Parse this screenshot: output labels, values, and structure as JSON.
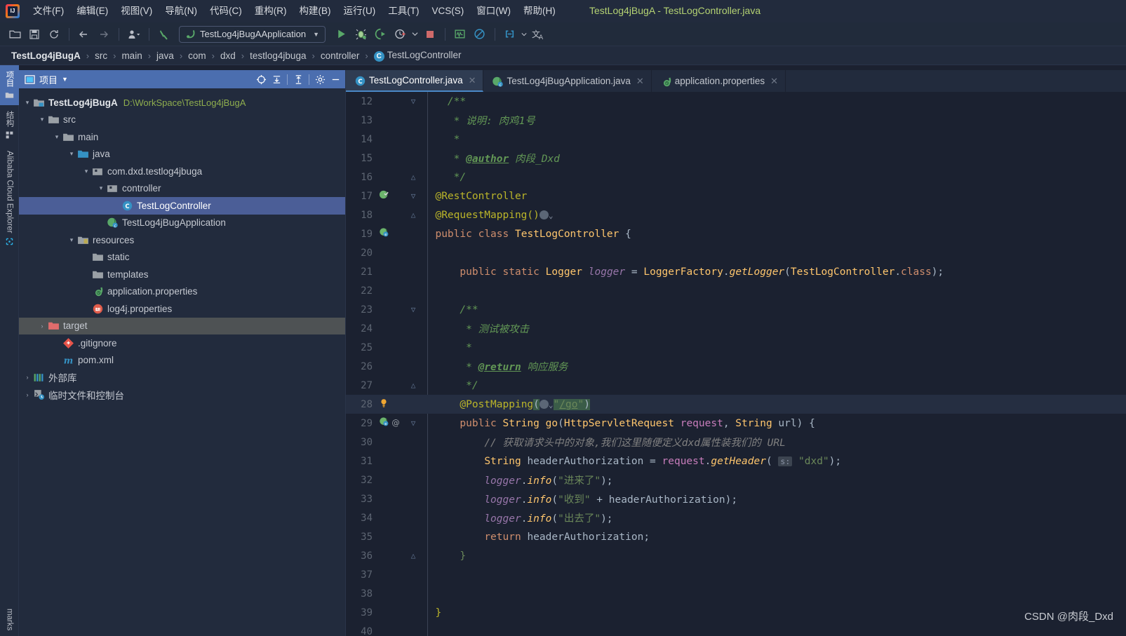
{
  "window": {
    "title": "TestLog4jBugA - TestLogController.java",
    "logo_icon": "intellij-idea-logo"
  },
  "menubar": {
    "items": [
      {
        "label": "文件(F)",
        "name": "menu-file"
      },
      {
        "label": "编辑(E)",
        "name": "menu-edit"
      },
      {
        "label": "视图(V)",
        "name": "menu-view"
      },
      {
        "label": "导航(N)",
        "name": "menu-navigate"
      },
      {
        "label": "代码(C)",
        "name": "menu-code"
      },
      {
        "label": "重构(R)",
        "name": "menu-refactor"
      },
      {
        "label": "构建(B)",
        "name": "menu-build"
      },
      {
        "label": "运行(U)",
        "name": "menu-run"
      },
      {
        "label": "工具(T)",
        "name": "menu-tools"
      },
      {
        "label": "VCS(S)",
        "name": "menu-vcs"
      },
      {
        "label": "窗口(W)",
        "name": "menu-window"
      },
      {
        "label": "帮助(H)",
        "name": "menu-help"
      }
    ]
  },
  "toolbar": {
    "run_configuration": "TestLog4jBugAApplication",
    "run_config_caret": "▼",
    "icons": [
      "open-folder-icon",
      "save-icon",
      "sync-refresh-icon",
      "back-arrow-icon",
      "forward-arrow-icon",
      "profile-user-icon",
      "build-hammer-icon",
      "run-icon",
      "debug-icon",
      "run-with-coverage-icon",
      "profiler-icon",
      "stop-icon",
      "monitor-icon",
      "no-entry-icon",
      "link-icon",
      "translate-icon"
    ]
  },
  "breadcrumb": {
    "items": [
      "TestLog4jBugA",
      "src",
      "main",
      "java",
      "com",
      "dxd",
      "testlog4jbuga",
      "controller",
      "TestLogController"
    ],
    "separator": "›",
    "class_icon_letter": "C"
  },
  "left_rail": {
    "top_items": [
      {
        "label": "项目",
        "icon": "project-folder-icon",
        "active": true,
        "name": "rail-project"
      },
      {
        "label": "结构",
        "icon": "structure-icon",
        "active": false,
        "name": "rail-structure"
      },
      {
        "label": "Alibaba Cloud Explorer",
        "icon": "cloud-explorer-icon",
        "active": false,
        "name": "rail-alibaba-cloud-explorer"
      }
    ],
    "bottom_items": [
      {
        "label": "marks",
        "icon": "bookmarks-icon",
        "active": false,
        "name": "rail-bookmarks"
      }
    ]
  },
  "project_panel": {
    "header_title": "项目",
    "header_caret": "▼",
    "header_icons": [
      "select-opened-file-icon",
      "expand-all-icon",
      "collapse-all-icon",
      "gear-icon",
      "hide-icon"
    ],
    "tree": [
      {
        "depth": 0,
        "arrow": "▾",
        "icon": "module-folder-icon",
        "label": "TestLog4jBugA",
        "bold": true,
        "path": "D:\\WorkSpace\\TestLog4jBugA",
        "state": "normal",
        "name": "tree-node-project-root"
      },
      {
        "depth": 1,
        "arrow": "▾",
        "icon": "folder-icon",
        "label": "src",
        "bold": false,
        "path": "",
        "state": "normal",
        "name": "tree-node-src"
      },
      {
        "depth": 2,
        "arrow": "▾",
        "icon": "folder-icon",
        "label": "main",
        "bold": false,
        "path": "",
        "state": "normal",
        "name": "tree-node-main"
      },
      {
        "depth": 3,
        "arrow": "▾",
        "icon": "source-folder-icon",
        "label": "java",
        "bold": false,
        "path": "",
        "state": "normal",
        "name": "tree-node-java"
      },
      {
        "depth": 4,
        "arrow": "▾",
        "icon": "package-icon",
        "label": "com.dxd.testlog4jbuga",
        "bold": false,
        "path": "",
        "state": "normal",
        "name": "tree-node-package-com-dxd-testlog4jbuga"
      },
      {
        "depth": 5,
        "arrow": "▾",
        "icon": "package-icon",
        "label": "controller",
        "bold": false,
        "path": "",
        "state": "normal",
        "name": "tree-node-package-controller"
      },
      {
        "depth": 6,
        "arrow": "",
        "icon": "java-class-icon",
        "label": "TestLogController",
        "bold": false,
        "path": "",
        "state": "selected",
        "name": "tree-node-testlogcontroller"
      },
      {
        "depth": 5,
        "arrow": "",
        "icon": "spring-boot-class-icon",
        "label": "TestLog4jBugApplication",
        "bold": false,
        "path": "",
        "state": "normal",
        "name": "tree-node-testlog4jbugapplication"
      },
      {
        "depth": 3,
        "arrow": "▾",
        "icon": "resources-folder-icon",
        "label": "resources",
        "bold": false,
        "path": "",
        "state": "normal",
        "name": "tree-node-resources"
      },
      {
        "depth": 4,
        "arrow": "",
        "icon": "folder-icon",
        "label": "static",
        "bold": false,
        "path": "",
        "state": "normal",
        "name": "tree-node-static"
      },
      {
        "depth": 4,
        "arrow": "",
        "icon": "folder-icon",
        "label": "templates",
        "bold": false,
        "path": "",
        "state": "normal",
        "name": "tree-node-templates"
      },
      {
        "depth": 4,
        "arrow": "",
        "icon": "spring-properties-icon",
        "label": "application.properties",
        "bold": false,
        "path": "",
        "state": "normal",
        "name": "tree-node-application-properties"
      },
      {
        "depth": 4,
        "arrow": "",
        "icon": "log4j-properties-icon",
        "label": "log4j.properties",
        "bold": false,
        "path": "",
        "state": "normal",
        "name": "tree-node-log4j-properties"
      },
      {
        "depth": 1,
        "arrow": "›",
        "icon": "excluded-folder-icon",
        "label": "target",
        "bold": false,
        "path": "",
        "state": "hovered",
        "name": "tree-node-target"
      },
      {
        "depth": 2,
        "arrow": "",
        "icon": "gitignore-icon",
        "label": ".gitignore",
        "bold": false,
        "path": "",
        "state": "normal",
        "name": "tree-node-gitignore"
      },
      {
        "depth": 2,
        "arrow": "",
        "icon": "maven-icon",
        "label": "pom.xml",
        "bold": false,
        "path": "",
        "state": "normal",
        "name": "tree-node-pom-xml"
      },
      {
        "depth": 0,
        "arrow": "›",
        "icon": "external-libraries-icon",
        "label": "外部库",
        "bold": false,
        "path": "",
        "state": "normal",
        "name": "tree-node-external-libraries"
      },
      {
        "depth": 0,
        "arrow": "›",
        "icon": "scratches-icon",
        "label": "临时文件和控制台",
        "bold": false,
        "path": "",
        "state": "normal",
        "name": "tree-node-scratches-and-consoles"
      }
    ]
  },
  "editor": {
    "tabs": [
      {
        "label": "TestLogController.java",
        "icon": "java-class-icon",
        "active": true,
        "closable": true,
        "name": "tab-testlogcontroller-java"
      },
      {
        "label": "TestLog4jBugApplication.java",
        "icon": "spring-boot-class-icon",
        "active": false,
        "closable": true,
        "name": "tab-testlog4jbugapplication-java"
      },
      {
        "label": "application.properties",
        "icon": "spring-properties-icon",
        "active": false,
        "closable": true,
        "name": "tab-application-properties"
      }
    ],
    "first_visible_line": 12,
    "current_line": 28,
    "lines": [
      {
        "no": 12,
        "fold": "▽",
        "gutter": "",
        "html": "    <span class=\"doc\">/**</span>"
      },
      {
        "no": 13,
        "fold": "",
        "gutter": "",
        "html": "     <span class=\"doc\">* 说明: 肉鸡1号</span>"
      },
      {
        "no": 14,
        "fold": "",
        "gutter": "",
        "html": "     <span class=\"doc\">*</span>"
      },
      {
        "no": 15,
        "fold": "",
        "gutter": "",
        "html": "     <span class=\"doc\">* </span><span class=\"tag\">@author</span><span class=\"doc\"> 肉段_Dxd</span>"
      },
      {
        "no": 16,
        "fold": "△",
        "gutter": "",
        "html": "     <span class=\"doc\">*/</span>"
      },
      {
        "no": 17,
        "fold": "▽",
        "gutter": "spring-bean-icon",
        "html": "  <span class=\"ann\">@RestController</span>"
      },
      {
        "no": 18,
        "fold": "△",
        "gutter": "",
        "html": "  <span class=\"ann\">@RequestMapping()</span><span class=\"webico-slot\"></span>"
      },
      {
        "no": 19,
        "fold": "",
        "gutter": "spring-endpoint-icon",
        "html": "  <span class=\"kw\">public</span> <span class=\"kw\">class</span> <span class=\"cls\">TestLogController</span> <span class=\"plain\">{</span>"
      },
      {
        "no": 20,
        "fold": "",
        "gutter": "",
        "html": ""
      },
      {
        "no": 21,
        "fold": "",
        "gutter": "",
        "html": "      <span class=\"kw\">public</span> <span class=\"kw\">static</span> <span class=\"cls\">Logger</span> <span class=\"fld\">logger</span> <span class=\"plain\">=</span> <span class=\"cls\">LoggerFactory</span><span class=\"plain\">.</span><span class=\"mth\">getLogger</span><span class=\"plain\">(</span><span class=\"cls\">TestLogController</span><span class=\"plain\">.</span><span class=\"kw\">class</span><span class=\"plain\">);</span>"
      },
      {
        "no": 22,
        "fold": "",
        "gutter": "",
        "html": ""
      },
      {
        "no": 23,
        "fold": "▽",
        "gutter": "",
        "html": "      <span class=\"doc\">/**</span>"
      },
      {
        "no": 24,
        "fold": "",
        "gutter": "",
        "html": "       <span class=\"doc\">* 测试被攻击</span>"
      },
      {
        "no": 25,
        "fold": "",
        "gutter": "",
        "html": "       <span class=\"doc\">*</span>"
      },
      {
        "no": 26,
        "fold": "",
        "gutter": "",
        "html": "       <span class=\"doc\">* </span><span class=\"tag\">@return</span><span class=\"doc\"> 响应服务</span>"
      },
      {
        "no": 27,
        "fold": "△",
        "gutter": "",
        "html": "       <span class=\"doc\">*/</span>"
      },
      {
        "no": 28,
        "fold": "",
        "gutter": "intention-bulb-icon",
        "html": "      <span class=\"ann\">@PostMapping</span><span class=\"sel\">(</span><span class=\"webico-slot\"></span><span class=\"sel str\">\"<span style=\"text-decoration:underline\">/go</span>\"</span><span class=\"sel\">)</span>"
      },
      {
        "no": 29,
        "fold": "▽",
        "gutter": "spring-endpoint-icon,override-icon",
        "html": "      <span class=\"kw\">public</span> <span class=\"cls\">String</span> <span class=\"mth2\">go</span><span class=\"plain\">(</span><span class=\"cls\">HttpServletRequest</span> <span class=\"param\">request</span><span class=\"plain\">,</span> <span class=\"cls\">String</span> <span class=\"ident\">url</span><span class=\"plain\">) {</span>"
      },
      {
        "no": 30,
        "fold": "",
        "gutter": "",
        "html": "          <span class=\"cmt2\">// 获取请求头中的对象,我们这里随便定义dxd属性装我们的 URL</span>"
      },
      {
        "no": 31,
        "fold": "",
        "gutter": "",
        "html": "          <span class=\"cls\">String</span> <span class=\"ident\">headerAuthorization</span> <span class=\"plain\">=</span> <span class=\"param\">request</span><span class=\"plain\">.</span><span class=\"mth\">getHeader</span><span class=\"plain\">(</span> <span class=\"hint\">s:</span> <span class=\"str\">\"dxd\"</span><span class=\"plain\">);</span>"
      },
      {
        "no": 32,
        "fold": "",
        "gutter": "",
        "html": "          <span class=\"fld\">logger</span><span class=\"plain\">.</span><span class=\"mth\">info</span><span class=\"plain\">(</span><span class=\"str\">\"进来了\"</span><span class=\"plain\">);</span>"
      },
      {
        "no": 33,
        "fold": "",
        "gutter": "",
        "html": "          <span class=\"fld\">logger</span><span class=\"plain\">.</span><span class=\"mth\">info</span><span class=\"plain\">(</span><span class=\"str\">\"收到\"</span> <span class=\"plain\">+</span> <span class=\"ident\">headerAuthorization</span><span class=\"plain\">);</span>"
      },
      {
        "no": 34,
        "fold": "",
        "gutter": "",
        "html": "          <span class=\"fld\">logger</span><span class=\"plain\">.</span><span class=\"mth\">info</span><span class=\"plain\">(</span><span class=\"str\">\"出去了\"</span><span class=\"plain\">);</span>"
      },
      {
        "no": 35,
        "fold": "",
        "gutter": "",
        "html": "          <span class=\"kw\">return</span> <span class=\"ident\">headerAuthorization</span><span class=\"plain\">;</span>"
      },
      {
        "no": 36,
        "fold": "△",
        "gutter": "",
        "html": "      <span class=\"str\">}</span>"
      },
      {
        "no": 37,
        "fold": "",
        "gutter": "",
        "html": ""
      },
      {
        "no": 38,
        "fold": "",
        "gutter": "",
        "html": ""
      },
      {
        "no": 39,
        "fold": "",
        "gutter": "",
        "html": "  <span class=\"ann\">}</span>"
      },
      {
        "no": 40,
        "fold": "",
        "gutter": "",
        "html": ""
      }
    ]
  },
  "watermark": "CSDN @肉段_Dxd",
  "colors": {
    "accent_blue": "#4b6eaf",
    "title_green": "#b4d273",
    "path_green": "#8fae4e",
    "editor_bg": "#1b2130",
    "panel_bg": "#222b3d",
    "selection_blue": "#4b5e97"
  }
}
